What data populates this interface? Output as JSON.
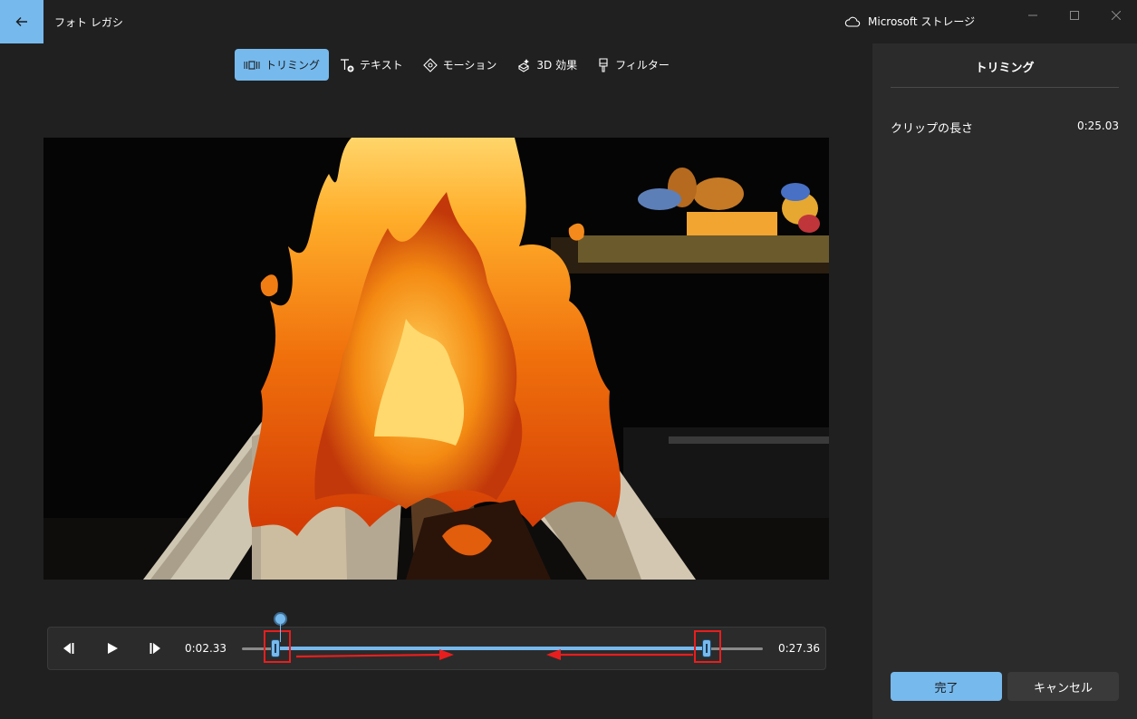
{
  "app": {
    "title": "フォト レガシ"
  },
  "header": {
    "storage_label": "Microsoft ストレージ"
  },
  "toolbar": {
    "items": [
      {
        "label": "トリミング",
        "icon": "trim-icon",
        "active": true
      },
      {
        "label": "テキスト",
        "icon": "text-icon",
        "active": false
      },
      {
        "label": "モーション",
        "icon": "motion-icon",
        "active": false
      },
      {
        "label": "3D 効果",
        "icon": "3d-effects-icon",
        "active": false
      },
      {
        "label": "フィルター",
        "icon": "filter-icon",
        "active": false
      }
    ]
  },
  "timeline": {
    "start_time": "0:02.33",
    "end_time": "0:27.36"
  },
  "panel": {
    "title": "トリミング",
    "clip_length_label": "クリップの長さ",
    "clip_length_value": "0:25.03",
    "done_label": "完了",
    "cancel_label": "キャンセル"
  },
  "colors": {
    "accent": "#76b9ed",
    "background": "#202020",
    "panel": "#2b2b2b",
    "annotation": "#e81e1e"
  }
}
